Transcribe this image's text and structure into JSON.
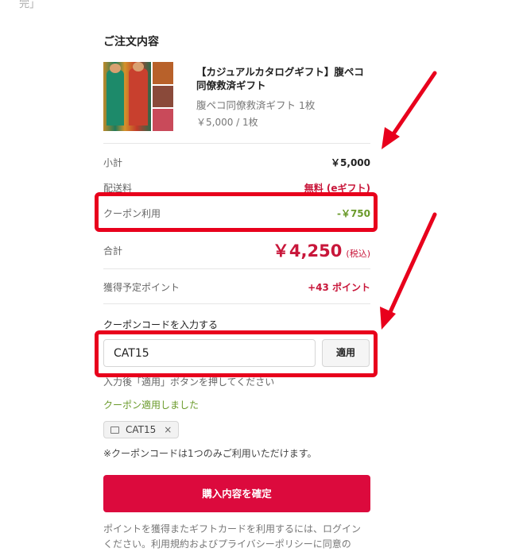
{
  "top_fragment": "完」",
  "order_section": {
    "title": "ご注文内容",
    "product": {
      "name": "【カジュアルカタログギフト】腹ペコ同僚救済ギフト",
      "variant": "腹ペコ同僚救済ギフト 1枚",
      "unit_price": "￥5,000 / 1枚"
    }
  },
  "summary": {
    "subtotal": {
      "label": "小計",
      "value": "￥5,000"
    },
    "shipping": {
      "label": "配送料",
      "value": "無料 (eギフト)"
    },
    "coupon": {
      "label": "クーポン利用",
      "value": "-￥750"
    },
    "total": {
      "label": "合計",
      "value": "￥4,250",
      "tax": "(税込)"
    },
    "points": {
      "label": "獲得予定ポイント",
      "value": "+43 ポイント"
    }
  },
  "coupon_form": {
    "label": "クーポンコードを入力する",
    "input_value": "CAT15",
    "apply_label": "適用",
    "hint": "入力後「適用」ボタンを押してください",
    "status": "クーポン適用しました",
    "applied_code": "CAT15",
    "remove_symbol": "×",
    "note": "※クーポンコードは1つのみご利用いただけます。"
  },
  "confirm_button": "購入内容を確定",
  "footer_text_line1": "ポイントを獲得またギフトカードを利用するには、ログイン",
  "footer_text_line2": "ください。利用規約およびプライバシーポリシーに同意の",
  "colors": {
    "accent": "#dc0a3d",
    "price_red": "#c8163a",
    "discount_green": "#6a9a2a",
    "annotation_red": "#e8001c"
  },
  "icons": [
    "ticket-icon",
    "close-icon",
    "arrow-annotation"
  ]
}
